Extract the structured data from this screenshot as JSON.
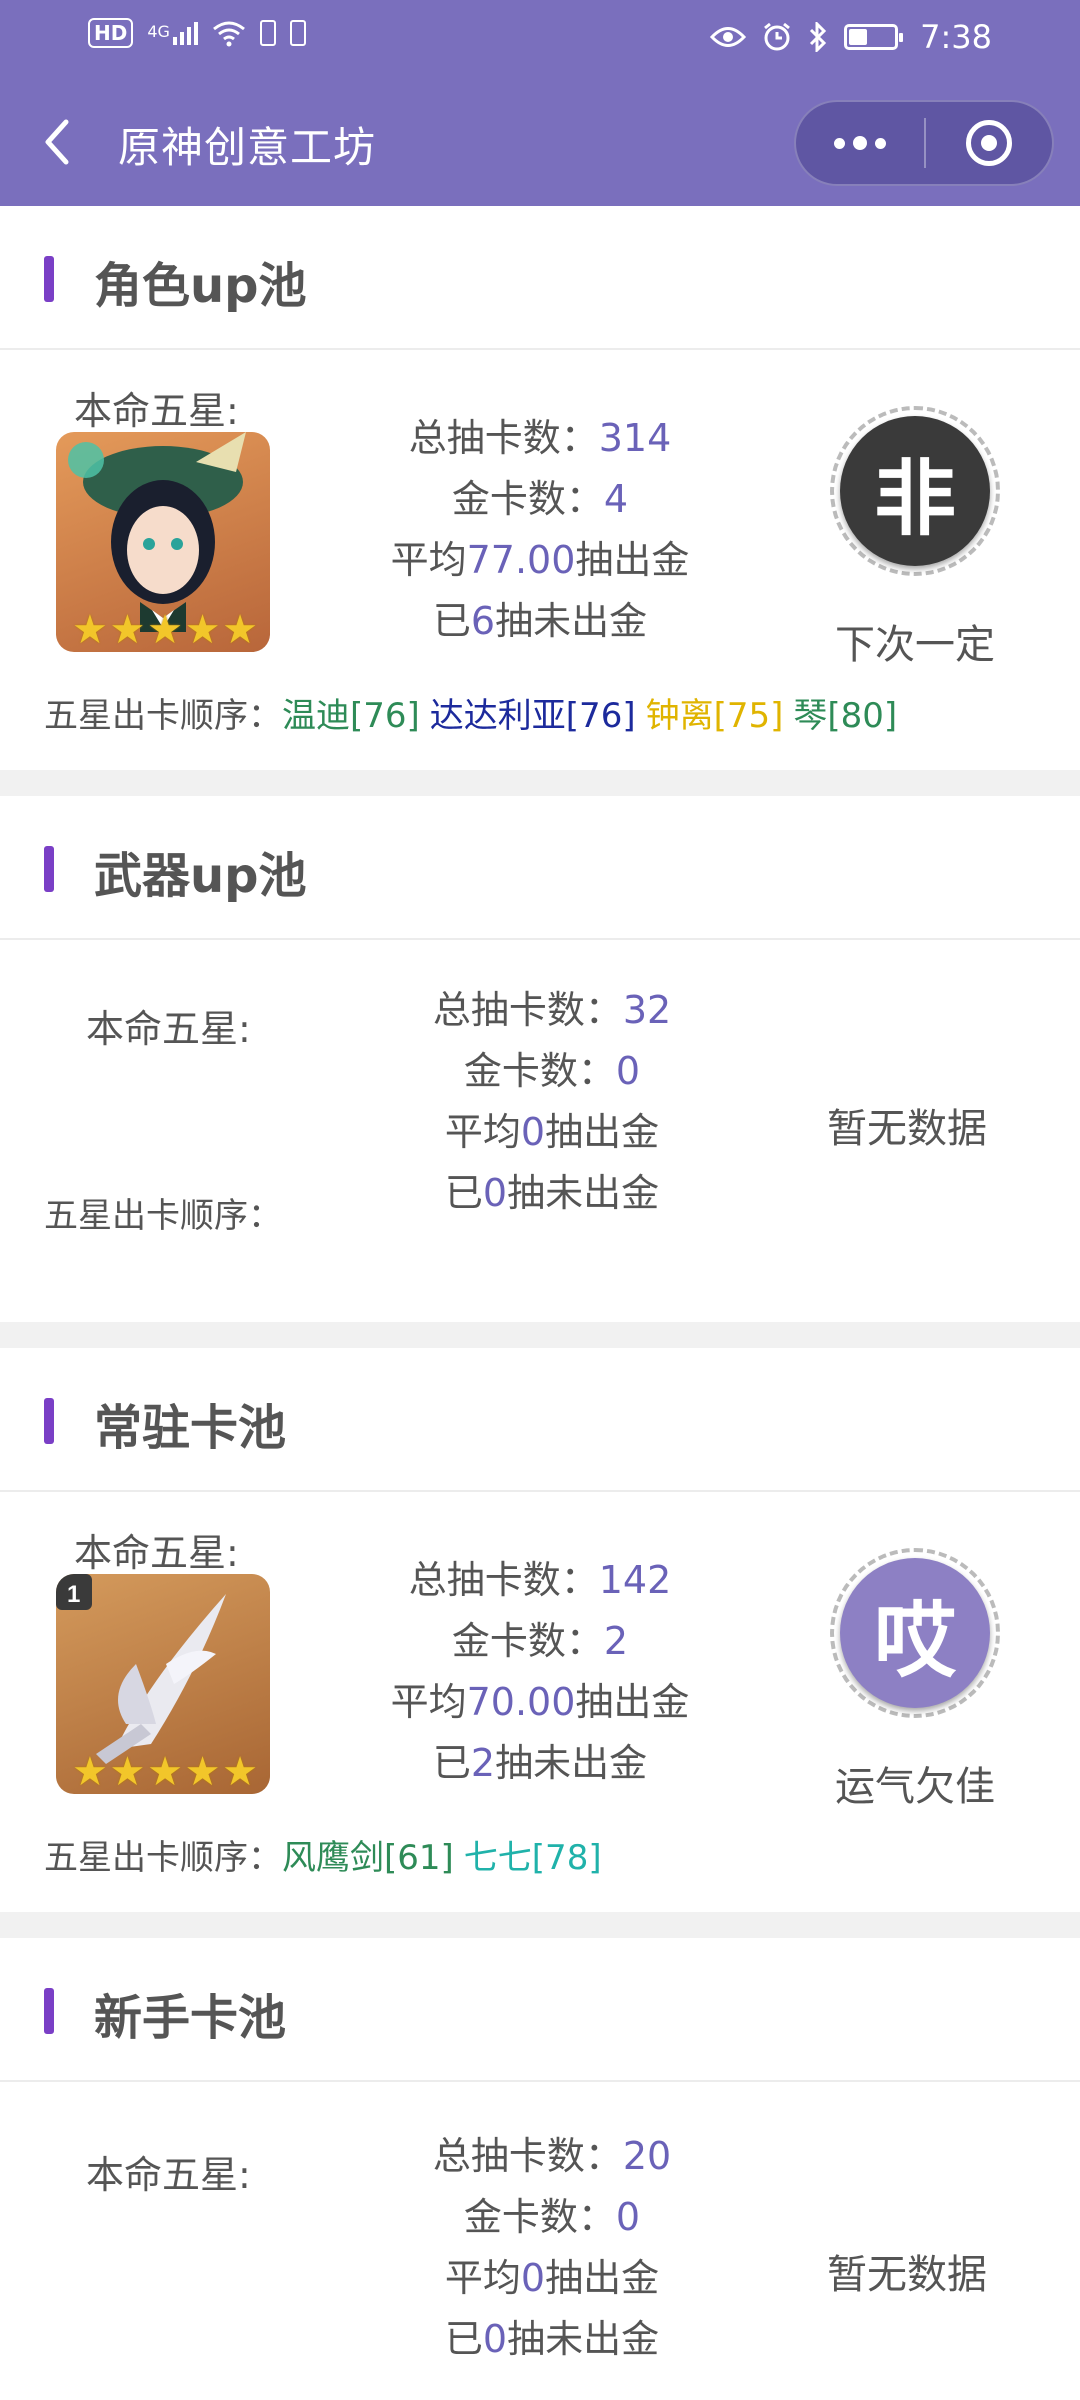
{
  "status_bar": {
    "hd": "HD",
    "network": "4G",
    "time": "7:38"
  },
  "nav": {
    "title": "原神创意工坊"
  },
  "colors": {
    "brand": "#7a6fbd",
    "accent_bar": "#7a3fc6",
    "number": "#6a62b8"
  },
  "pools": [
    {
      "title": "角色up池",
      "life_label": "本命五星:",
      "stats": {
        "total_prefix": "总抽卡数：",
        "total": "314",
        "gold_prefix": "金卡数：",
        "gold": "4",
        "avg_prefix": "平均",
        "avg": "77.00",
        "avg_suffix": "抽出金",
        "since_prefix": "已",
        "since": "6",
        "since_suffix": "抽未出金"
      },
      "badge_char": "非",
      "verdict": "下次一定",
      "order_label": "五星出卡顺序：",
      "order": [
        {
          "text": "温迪[76]",
          "color": "#2e8b57"
        },
        {
          "text": "达达利亚[76]",
          "color": "#1c2a9c"
        },
        {
          "text": "钟离[75]",
          "color": "#e0b400"
        },
        {
          "text": "琴[80]",
          "color": "#2e8b57"
        }
      ]
    },
    {
      "title": "武器up池",
      "life_label": "本命五星:",
      "stats": {
        "total_prefix": "总抽卡数：",
        "total": "32",
        "gold_prefix": "金卡数：",
        "gold": "0",
        "avg_prefix": "平均",
        "avg": "0",
        "avg_suffix": "抽出金",
        "since_prefix": "已",
        "since": "0",
        "since_suffix": "抽未出金"
      },
      "verdict": "暂无数据",
      "order_label": "五星出卡顺序："
    },
    {
      "title": "常驻卡池",
      "life_label": "本命五星:",
      "stats": {
        "total_prefix": "总抽卡数：",
        "total": "142",
        "gold_prefix": "金卡数：",
        "gold": "2",
        "avg_prefix": "平均",
        "avg": "70.00",
        "avg_suffix": "抽出金",
        "since_prefix": "已",
        "since": "2",
        "since_suffix": "抽未出金"
      },
      "badge_char": "哎",
      "verdict": "运气欠佳",
      "order_label": "五星出卡顺序：",
      "order": [
        {
          "text": "风鹰剑[61]",
          "color": "#2e8b57"
        },
        {
          "text": "七七[78]",
          "color": "#20b2aa"
        }
      ]
    },
    {
      "title": "新手卡池",
      "life_label": "本命五星:",
      "stats": {
        "total_prefix": "总抽卡数：",
        "total": "20",
        "gold_prefix": "金卡数：",
        "gold": "0",
        "avg_prefix": "平均",
        "avg": "0",
        "avg_suffix": "抽出金",
        "since_prefix": "已",
        "since": "0",
        "since_suffix": "抽未出金"
      },
      "verdict": "暂无数据"
    }
  ],
  "icons": [
    "hd-icon",
    "signal-icon",
    "wifi-icon",
    "sim-icon",
    "eye-icon",
    "alarm-icon",
    "bluetooth-icon",
    "battery-icon",
    "back-arrow-icon",
    "more-dots-icon",
    "close-target-icon",
    "star-icon"
  ]
}
